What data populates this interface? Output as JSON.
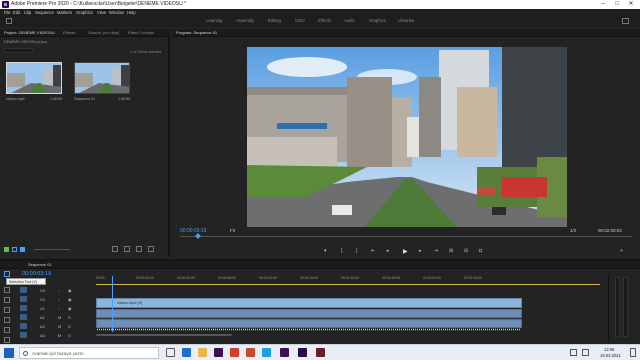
{
  "app": {
    "title": "Adobe Premiere Pro 2020 - C:\\Kullanıcılar\\User\\Belgeler\\DENEME VIDEOSU *"
  },
  "menu": [
    "File",
    "Edit",
    "Clip",
    "Sequence",
    "Markers",
    "Graphics",
    "View",
    "Window",
    "Help"
  ],
  "workspaces": [
    "Learning",
    "Assembly",
    "Editing",
    "Color",
    "Effects",
    "Audio",
    "Graphics",
    "Libraries"
  ],
  "project": {
    "tabs": [
      "Project: DENEME VIDEOSU",
      "Effects",
      "Source: (no clips)",
      "Effect Controls"
    ],
    "path": "DENEME VIDEOSU.prproj",
    "count": "1 of 2 items selected",
    "items": [
      {
        "name": "videoo.mp4",
        "duration": "1:30:50"
      },
      {
        "name": "Sequence 01",
        "duration": "1:30:54"
      }
    ]
  },
  "program": {
    "tab": "Program: Sequence 01",
    "timecode": "00:00:03:19",
    "fit": "Fit",
    "zoom": "1/2",
    "duration": "00:02:00:04"
  },
  "timeline": {
    "tab": "Sequence 01",
    "timecode": "00:00:03:19",
    "tooltip": "Selection Tool (V)",
    "ruler": [
      "00:00",
      "00:00:15:00",
      "00:00:30:00",
      "00:00:45:00",
      "00:01:00:00",
      "00:01:15:00",
      "00:01:30:00",
      "00:01:45:00",
      "00:02:00:00",
      "00:02:15:00"
    ],
    "tracks": [
      "V3",
      "V2",
      "V1",
      "A1",
      "A2",
      "A3"
    ],
    "clip_label": "videoo.mp4 [V]",
    "playhead_fraction": 0.032
  },
  "taskbar": {
    "search_placeholder": "Aramak için buraya yazın",
    "time": "12:06",
    "date": "19.03.2021"
  },
  "colors": {
    "accent": "#4a9eff",
    "clip_video": "#8fb4d9",
    "clip_audio": "#6d8fb8"
  }
}
